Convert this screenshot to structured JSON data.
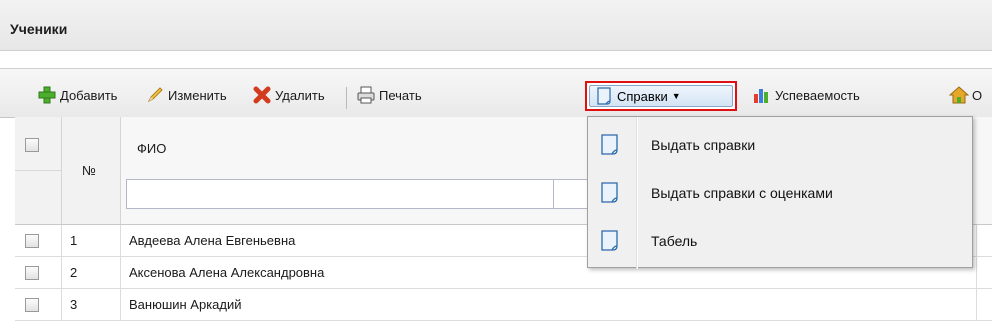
{
  "panel": {
    "title": "Ученики"
  },
  "toolbar": {
    "add_label": "Добавить",
    "edit_label": "Изменить",
    "delete_label": "Удалить",
    "print_label": "Печать",
    "spravki_label": "Справки",
    "progress_label": "Успеваемость",
    "cut_label": "О"
  },
  "grid": {
    "columns": {
      "number": "№",
      "fio": "ФИО"
    },
    "filter": {
      "fio_value": ""
    },
    "rows": [
      {
        "num": "1",
        "fio": "Авдеева Алена Евгеньевна"
      },
      {
        "num": "2",
        "fio": "Аксенова Алена Александровна"
      },
      {
        "num": "3",
        "fio": "Ванюшин Аркадий"
      }
    ]
  },
  "spravki_menu": {
    "items": [
      {
        "label": "Выдать справки"
      },
      {
        "label": "Выдать справки с оценками"
      },
      {
        "label": "Табель"
      }
    ]
  },
  "colors": {
    "highlight_border": "#e01010",
    "button_hover": "#d4e4f4"
  }
}
